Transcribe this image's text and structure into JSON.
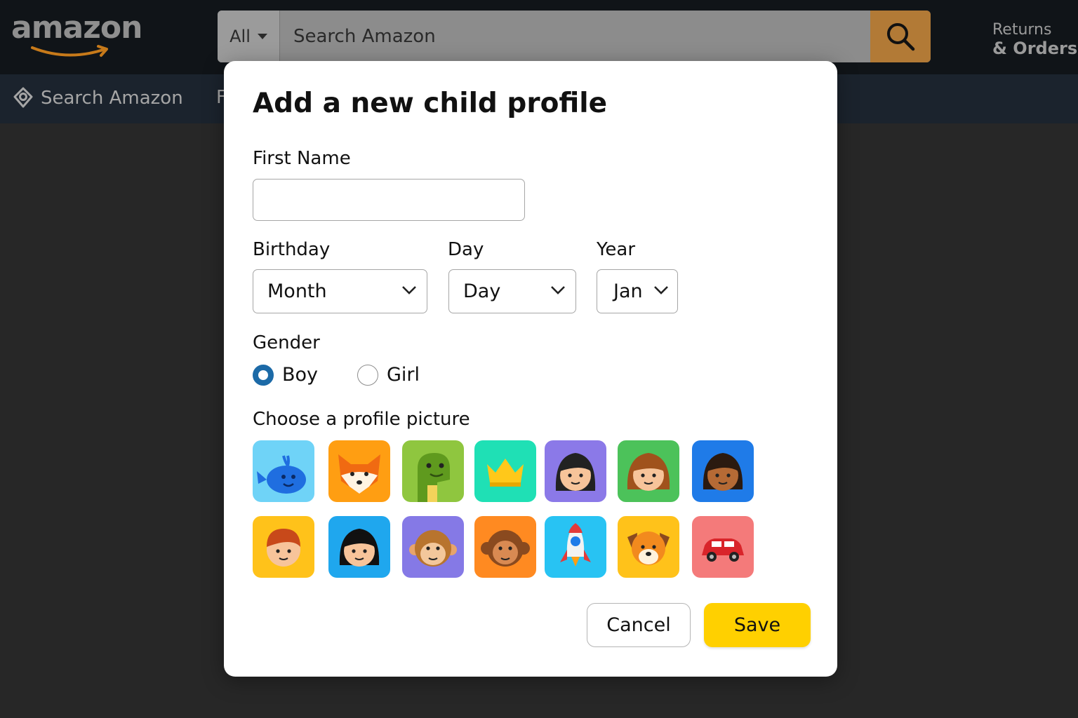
{
  "header": {
    "logo_text": "amazon",
    "search_category": "All",
    "search_placeholder": "Search Amazon",
    "returns_line1": "Returns",
    "returns_line2": "& Orders"
  },
  "subnav": {
    "location_text": "Search Amazon",
    "partial_text": "F"
  },
  "modal": {
    "title": "Add a new child profile",
    "first_name_label": "First Name",
    "first_name_value": "",
    "birthday_label": "Birthday",
    "day_label": "Day",
    "year_label": "Year",
    "month_select": "Month",
    "day_select": "Day",
    "year_select": "Jan",
    "gender_label": "Gender",
    "gender_options": [
      "Boy",
      "Girl"
    ],
    "gender_selected": "Boy",
    "picture_label": "Choose a profile picture",
    "avatars": [
      {
        "icon": "whale-icon",
        "bg": "#6fd3f7"
      },
      {
        "icon": "fox-icon",
        "bg": "#ff9e12"
      },
      {
        "icon": "dinosaur-icon",
        "bg": "#8fc63f"
      },
      {
        "icon": "crown-icon",
        "bg": "#1fe0b5"
      },
      {
        "icon": "girl-dark-hair-icon",
        "bg": "#8b79e8"
      },
      {
        "icon": "girl-brown-hair-icon",
        "bg": "#4cc25a"
      },
      {
        "icon": "girl-dark-skin-icon",
        "bg": "#1f7be8"
      },
      {
        "icon": "boy-red-hair-icon",
        "bg": "#ffc21a"
      },
      {
        "icon": "girl-black-hair-icon",
        "bg": "#1fa7ee"
      },
      {
        "icon": "monkey-icon",
        "bg": "#8579e6"
      },
      {
        "icon": "monkey-orange-icon",
        "bg": "#ff8a21"
      },
      {
        "icon": "rocket-icon",
        "bg": "#28c3f3"
      },
      {
        "icon": "dog-icon",
        "bg": "#ffc21a"
      },
      {
        "icon": "car-icon",
        "bg": "#f47a7a"
      }
    ],
    "cancel_label": "Cancel",
    "save_label": "Save"
  }
}
